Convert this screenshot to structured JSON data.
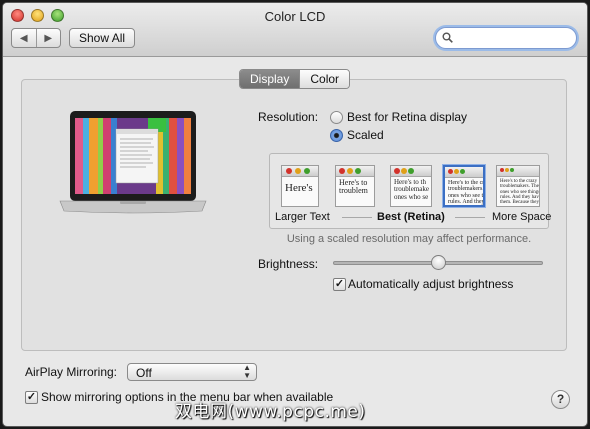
{
  "window": {
    "title": "Color LCD"
  },
  "toolbar": {
    "back_glyph": "◀",
    "forward_glyph": "▶",
    "show_all_label": "Show All",
    "search_value": "",
    "search_placeholder": ""
  },
  "tabs": [
    {
      "label": "Display",
      "active": true
    },
    {
      "label": "Color",
      "active": false
    }
  ],
  "resolution": {
    "label": "Resolution:",
    "options": [
      {
        "label": "Best for Retina display",
        "selected": false
      },
      {
        "label": "Scaled",
        "selected": true
      }
    ],
    "scaled_choices": {
      "thumbs": [
        {
          "text": "Here's",
          "selected": false
        },
        {
          "text": "Here's to\ntroublem",
          "selected": false
        },
        {
          "text": "Here's to th\ntroublemake\nones who se",
          "selected": false
        },
        {
          "text": "Here's to the cr\ntroublemakers.\nones who see t\nrules. And they",
          "selected": true
        },
        {
          "text": "Here's to the crazy\ntroublemakers. The\nones who see things\nrules. And they have\nthem. Because they c",
          "selected": false
        }
      ],
      "labels": {
        "left": "Larger Text",
        "middle": "Best (Retina)",
        "right": "More Space"
      }
    },
    "hint": "Using a scaled resolution may affect performance."
  },
  "brightness": {
    "label": "Brightness:",
    "level": 0.5,
    "auto_label": "Automatically adjust brightness",
    "auto_checked": true
  },
  "airplay": {
    "label": "AirPlay Mirroring:",
    "value": "Off",
    "show_in_menu_label": "Show mirroring options in the menu bar when available",
    "show_in_menu_checked": true
  },
  "help": {
    "glyph": "?"
  },
  "watermark": {
    "text": "双电网(www.pcpc.me)"
  },
  "colors": {
    "accent": "#3b6fc4",
    "close": "#d2322b",
    "minimize": "#e0a019",
    "zoom": "#3f9f2c"
  }
}
